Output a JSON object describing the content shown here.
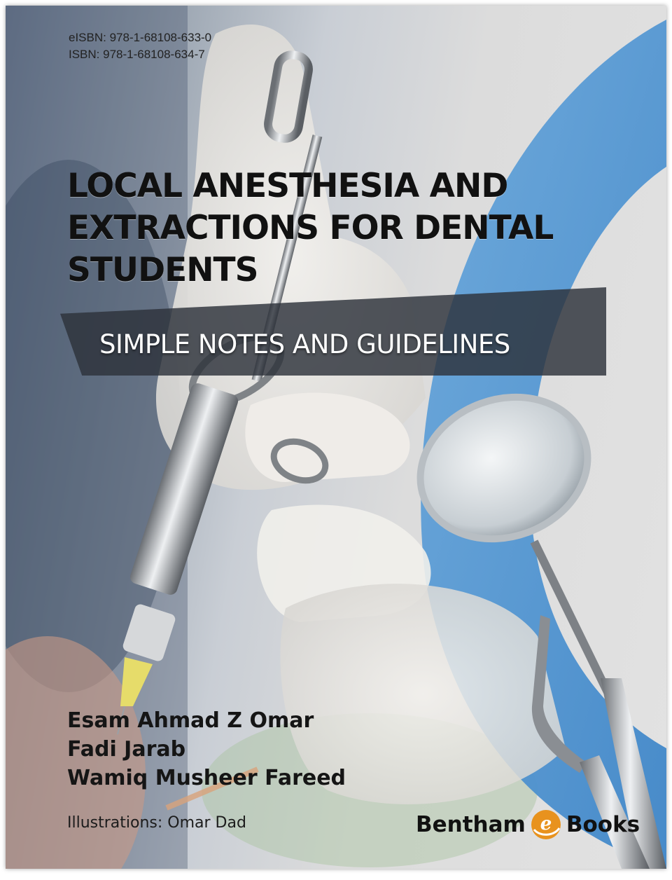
{
  "cover": {
    "eisbn": "eISBN: 978-1-68108-633-0",
    "isbn": "ISBN: 978-1-68108-634-7",
    "title_lines": [
      "LOCAL ANESTHESIA AND",
      "EXTRACTIONS FOR DENTAL",
      "STUDENTS"
    ],
    "subtitle": "SIMPLE NOTES AND GUIDELINES",
    "authors": [
      "Esam Ahmad Z Omar",
      "Fadi Jarab",
      "Wamiq Musheer Fareed"
    ],
    "illustrations": "Illustrations: Omar Dad",
    "publisher": {
      "left": "Bentham",
      "logo_letter": "e",
      "right": "Books"
    }
  },
  "colors": {
    "accent_arc": "#4a90cf",
    "subtitle_band": "#2d323a",
    "logo_orange": "#e8921e"
  },
  "icons": [
    "syringe-illustration",
    "dental-mirror-illustration",
    "dental-elevator-illustration",
    "bentham-e-logo"
  ]
}
